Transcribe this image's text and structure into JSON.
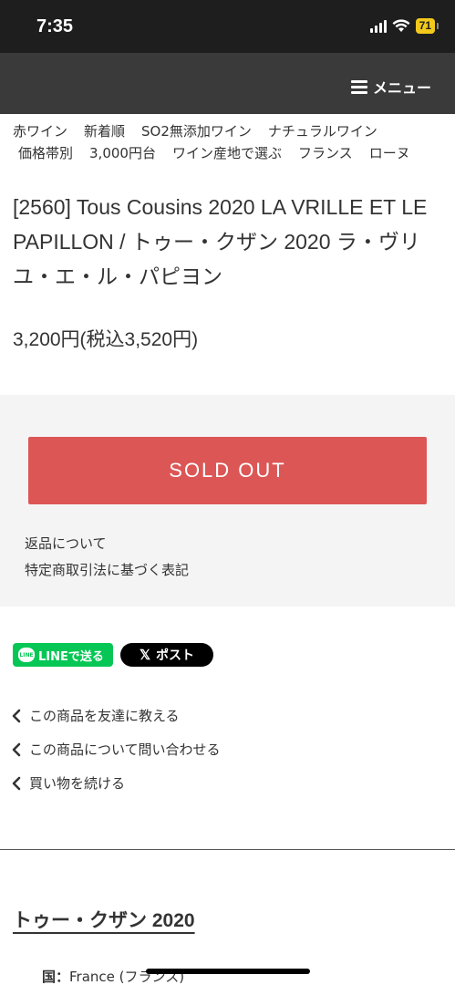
{
  "status_bar": {
    "time": "7:35",
    "battery": "71"
  },
  "header": {
    "menu_label": "メニュー"
  },
  "breadcrumb": {
    "line1": [
      "赤ワイン",
      "新着順",
      "SO2無添加ワイン",
      "ナチュラルワイン"
    ],
    "line2": [
      "価格帯別",
      "3,000円台",
      "ワイン産地で選ぶ",
      "フランス",
      "ローヌ"
    ]
  },
  "product": {
    "title": "[2560] Tous Cousins 2020 LA VRILLE ET LE PAPILLON / トゥー・クザン 2020 ラ・ヴリユ・エ・ル・パピヨン",
    "price": "3,200円(税込3,520円)"
  },
  "purchase": {
    "sold_out_label": "SOLD OUT",
    "returns_link": "返品について",
    "legal_link": "特定商取引法に基づく表記"
  },
  "share": {
    "line_label": "LINEで送る",
    "line_logo_text": "LINE",
    "x_label": "ポスト"
  },
  "actions": [
    {
      "label": "この商品を友達に教える",
      "icon": "chevron-left-icon"
    },
    {
      "label": "この商品について問い合わせる",
      "icon": "chevron-left-icon"
    },
    {
      "label": "買い物を続ける",
      "icon": "chevron-left-icon"
    }
  ],
  "details": {
    "section_title": "トゥー・クザン 2020",
    "country_label": "国：",
    "country_value": "France (フランス)"
  },
  "colors": {
    "status_bar_bg": "#1e1e1e",
    "header_bg": "#3a3a3a",
    "sold_out_bg": "#dc5656",
    "panel_bg": "#f4f4f4",
    "line_green": "#06c755",
    "battery_yellow": "#f2c81b"
  }
}
